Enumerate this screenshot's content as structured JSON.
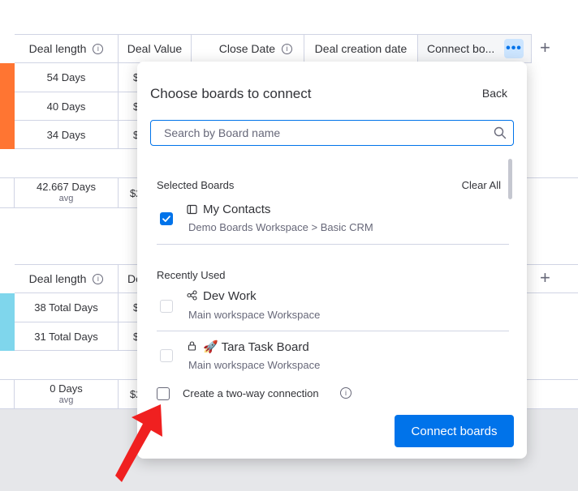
{
  "table": {
    "group1_headers": {
      "deal_length": "Deal length",
      "deal_value": "Deal Value",
      "close_date": "Close Date",
      "deal_creation_date": "Deal creation date",
      "connect_boards": "Connect bo..."
    },
    "group1_rows": [
      {
        "deal_length": "54 Days",
        "value_fragment": "$"
      },
      {
        "deal_length": "40 Days",
        "value_fragment": "$"
      },
      {
        "deal_length": "34 Days",
        "value_fragment": "$"
      }
    ],
    "group1_summary": {
      "value": "42.667 Days",
      "sub": "avg",
      "value_fragment": "$2"
    },
    "group2_headers": {
      "deal_length": "Deal length",
      "deal_value_fragment": "De"
    },
    "group2_rows": [
      {
        "deal_length": "38 Total Days",
        "value_fragment": "$"
      },
      {
        "deal_length": "31 Total Days",
        "value_fragment": "$"
      }
    ],
    "group2_summary": {
      "value": "0 Days",
      "sub": "avg",
      "value_fragment": "$2"
    },
    "more_button": "•••",
    "add_column": "+",
    "info_glyph": "i",
    "colors": {
      "group1": "#ff7532",
      "group2": "#7fd6ec"
    }
  },
  "dialog": {
    "title": "Choose boards to connect",
    "back": "Back",
    "search_placeholder": "Search by Board name",
    "selected_label": "Selected Boards",
    "clear_all": "Clear All",
    "selected_boards": [
      {
        "name": "My Contacts",
        "path": "Demo Boards Workspace > Basic CRM",
        "icon": "board-icon",
        "checked": true
      }
    ],
    "recent_label": "Recently Used",
    "recent_boards": [
      {
        "name": "Dev Work",
        "path": "Main workspace Workspace",
        "icon": "connected-nodes-icon",
        "checked": false
      },
      {
        "name": "🚀 Tara Task Board",
        "path": "Main workspace Workspace",
        "icon": "lock-icon",
        "checked": false
      }
    ],
    "two_way_label": "Create a two-way connection",
    "info_glyph": "i",
    "connect_button": "Connect boards",
    "accent": "#0073ea"
  }
}
